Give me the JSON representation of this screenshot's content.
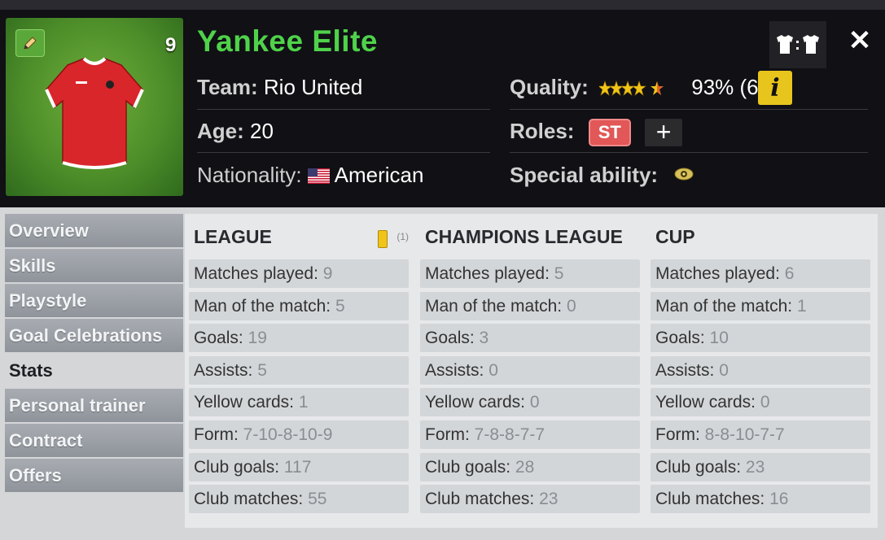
{
  "player": {
    "name": "Yankee Elite",
    "number": "9",
    "team_label": "Team:",
    "team": "Rio United",
    "age_label": "Age:",
    "age": "20",
    "nationality_label": "Nationality:",
    "nationality": "American",
    "quality_label": "Quality:",
    "quality_value": "93% (63)",
    "quality_stars": 4.5,
    "roles_label": "Roles:",
    "role": "ST",
    "special_ability_label": "Special ability:",
    "jersey_colors": {
      "primary": "#d9262b",
      "trim": "#ffffff"
    }
  },
  "header_buttons": {
    "shirt_icon": "shirt-swap-icon",
    "close_icon": "close-icon",
    "info_label": "i"
  },
  "sidebar": {
    "items": [
      {
        "label": "Overview",
        "active": false
      },
      {
        "label": "Skills",
        "active": false
      },
      {
        "label": "Playstyle",
        "active": false
      },
      {
        "label": "Goal Celebrations",
        "active": false
      },
      {
        "label": "Stats",
        "active": true
      },
      {
        "label": "Personal trainer",
        "active": false
      },
      {
        "label": "Contract",
        "active": false
      },
      {
        "label": "Offers",
        "active": false
      }
    ]
  },
  "stats": {
    "league": {
      "title": "LEAGUE",
      "yellow_card_count": "(1)",
      "rows": [
        {
          "label": "Matches played:",
          "value": "9"
        },
        {
          "label": "Man of the match:",
          "value": "5"
        },
        {
          "label": "Goals:",
          "value": "19"
        },
        {
          "label": "Assists:",
          "value": "5"
        },
        {
          "label": "Yellow cards:",
          "value": "1"
        },
        {
          "label": "Form:",
          "value": "7-10-8-10-9"
        },
        {
          "label": "Club goals:",
          "value": "117"
        },
        {
          "label": "Club matches:",
          "value": "55"
        }
      ]
    },
    "champions": {
      "title": "CHAMPIONS LEAGUE",
      "rows": [
        {
          "label": "Matches played:",
          "value": "5"
        },
        {
          "label": "Man of the match:",
          "value": "0"
        },
        {
          "label": "Goals:",
          "value": "3"
        },
        {
          "label": "Assists:",
          "value": "0"
        },
        {
          "label": "Yellow cards:",
          "value": "0"
        },
        {
          "label": "Form:",
          "value": "7-8-8-7-7"
        },
        {
          "label": "Club goals:",
          "value": "28"
        },
        {
          "label": "Club matches:",
          "value": "23"
        }
      ]
    },
    "cup": {
      "title": "CUP",
      "rows": [
        {
          "label": "Matches played:",
          "value": "6"
        },
        {
          "label": "Man of the match:",
          "value": "1"
        },
        {
          "label": "Goals:",
          "value": "10"
        },
        {
          "label": "Assists:",
          "value": "0"
        },
        {
          "label": "Yellow cards:",
          "value": "0"
        },
        {
          "label": "Form:",
          "value": "8-8-10-7-7"
        },
        {
          "label": "Club goals:",
          "value": "23"
        },
        {
          "label": "Club matches:",
          "value": "16"
        }
      ]
    }
  },
  "colors": {
    "name_green": "#4fd24a",
    "role_red": "#e25757",
    "info_yellow": "#e8c51c",
    "star_gold": "#f0c419"
  }
}
